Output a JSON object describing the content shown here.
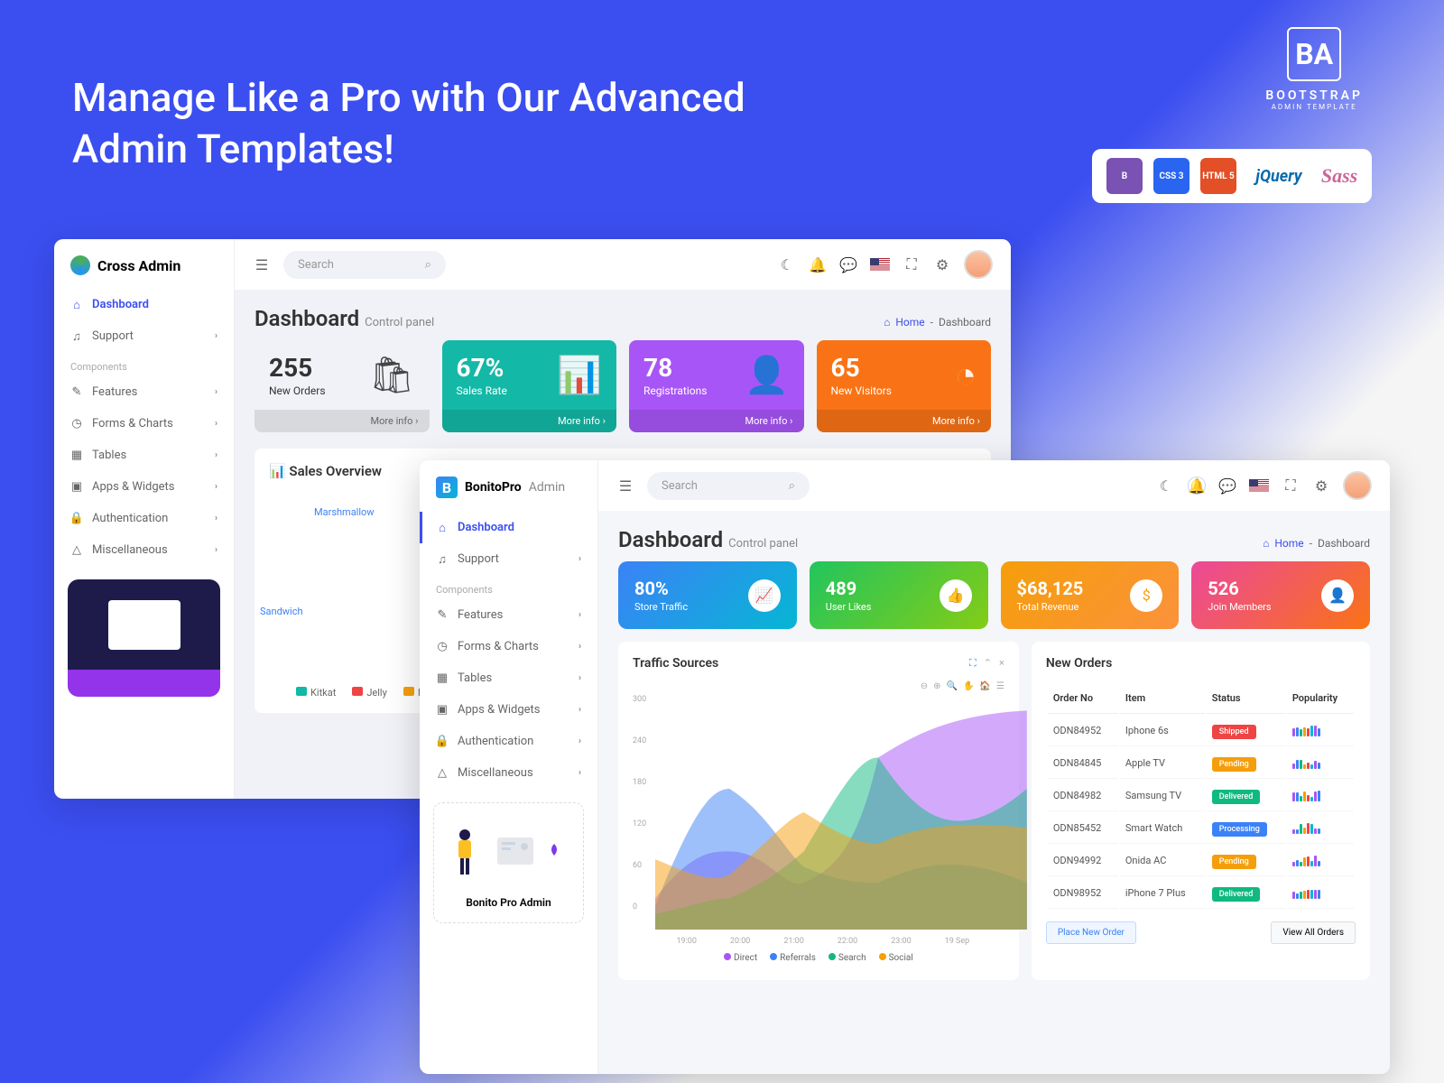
{
  "hero": {
    "title": "Manage Like a Pro with Our Advanced Admin Templates!"
  },
  "brand": {
    "logo": "BA",
    "name": "BOOTSTRAP",
    "sub": "ADMIN TEMPLATE"
  },
  "tech": [
    "B",
    "CSS 3",
    "HTML 5",
    "jQuery",
    "Sass"
  ],
  "dash1": {
    "logo_text": "Cross Admin",
    "search_placeholder": "Search",
    "nav": {
      "dashboard": "Dashboard",
      "support": "Support",
      "section": "Components",
      "features": "Features",
      "forms": "Forms & Charts",
      "tables": "Tables",
      "apps": "Apps & Widgets",
      "auth": "Authentication",
      "misc": "Miscellaneous"
    },
    "page_title": "Dashboard",
    "page_sub": "Control panel",
    "breadcrumb": {
      "home": "Home",
      "sep": "-",
      "current": "Dashboard"
    },
    "stats": [
      {
        "value": "255",
        "label": "New Orders",
        "link": "More info ›"
      },
      {
        "value": "67%",
        "label": "Sales Rate",
        "link": "More info ›"
      },
      {
        "value": "78",
        "label": "Registrations",
        "link": "More info ›"
      },
      {
        "value": "65",
        "label": "New Visitors",
        "link": "More info ›"
      }
    ],
    "sales_title": "Sales Overview",
    "donut_labels": {
      "top": "Marshmallow",
      "left": "Sandwich"
    },
    "legend": [
      "Kitkat",
      "Jelly",
      "Ice Cream"
    ]
  },
  "dash2": {
    "logo_text": "BonitoPro",
    "logo_suffix": "Admin",
    "search_placeholder": "Search",
    "nav": {
      "dashboard": "Dashboard",
      "support": "Support",
      "section": "Components",
      "features": "Features",
      "forms": "Forms & Charts",
      "tables": "Tables",
      "apps": "Apps & Widgets",
      "auth": "Authentication",
      "misc": "Miscellaneous"
    },
    "promo_title": "Bonito Pro Admin",
    "page_title": "Dashboard",
    "page_sub": "Control panel",
    "breadcrumb": {
      "home": "Home",
      "sep": "-",
      "current": "Dashboard"
    },
    "cards": [
      {
        "value": "80%",
        "label": "Store Traffic"
      },
      {
        "value": "489",
        "label": "User Likes"
      },
      {
        "value": "$68,125",
        "label": "Total Revenue"
      },
      {
        "value": "526",
        "label": "Join Members"
      }
    ],
    "traffic": {
      "title": "Traffic Sources",
      "y_ticks": [
        "300",
        "240",
        "180",
        "120",
        "60",
        "0"
      ],
      "x_ticks": [
        "19:00",
        "20:00",
        "21:00",
        "22:00",
        "23:00",
        "19 Sep"
      ],
      "legend": [
        "Direct",
        "Referrals",
        "Search",
        "Social"
      ]
    },
    "orders": {
      "title": "New Orders",
      "headers": {
        "order_no": "Order No",
        "item": "Item",
        "status": "Status",
        "popularity": "Popularity"
      },
      "rows": [
        {
          "no": "ODN84952",
          "item": "Iphone 6s",
          "status": "Shipped",
          "status_class": "bs-shipped"
        },
        {
          "no": "ODN84845",
          "item": "Apple TV",
          "status": "Pending",
          "status_class": "bs-pending"
        },
        {
          "no": "ODN84982",
          "item": "Samsung TV",
          "status": "Delivered",
          "status_class": "bs-delivered"
        },
        {
          "no": "ODN85452",
          "item": "Smart Watch",
          "status": "Processing",
          "status_class": "bs-processing"
        },
        {
          "no": "ODN94992",
          "item": "Onida AC",
          "status": "Pending",
          "status_class": "bs-pending"
        },
        {
          "no": "ODN98952",
          "item": "iPhone 7 Plus",
          "status": "Delivered",
          "status_class": "bs-delivered"
        }
      ],
      "btn_new": "Place New Order",
      "btn_all": "View All Orders"
    }
  },
  "chart_data": {
    "type": "area",
    "title": "Traffic Sources",
    "x": [
      "19:00",
      "20:00",
      "21:00",
      "22:00",
      "23:00",
      "19 Sep"
    ],
    "ylim": [
      0,
      300
    ],
    "series": [
      {
        "name": "Direct",
        "color": "#a855f7",
        "values": [
          40,
          100,
          120,
          60,
          200,
          280
        ]
      },
      {
        "name": "Referrals",
        "color": "#3b82f6",
        "values": [
          30,
          180,
          80,
          60,
          100,
          60
        ]
      },
      {
        "name": "Search",
        "color": "#10b981",
        "values": [
          20,
          40,
          100,
          220,
          100,
          180
        ]
      },
      {
        "name": "Social",
        "color": "#f59e0b",
        "values": [
          90,
          70,
          150,
          110,
          140,
          130
        ]
      }
    ]
  }
}
